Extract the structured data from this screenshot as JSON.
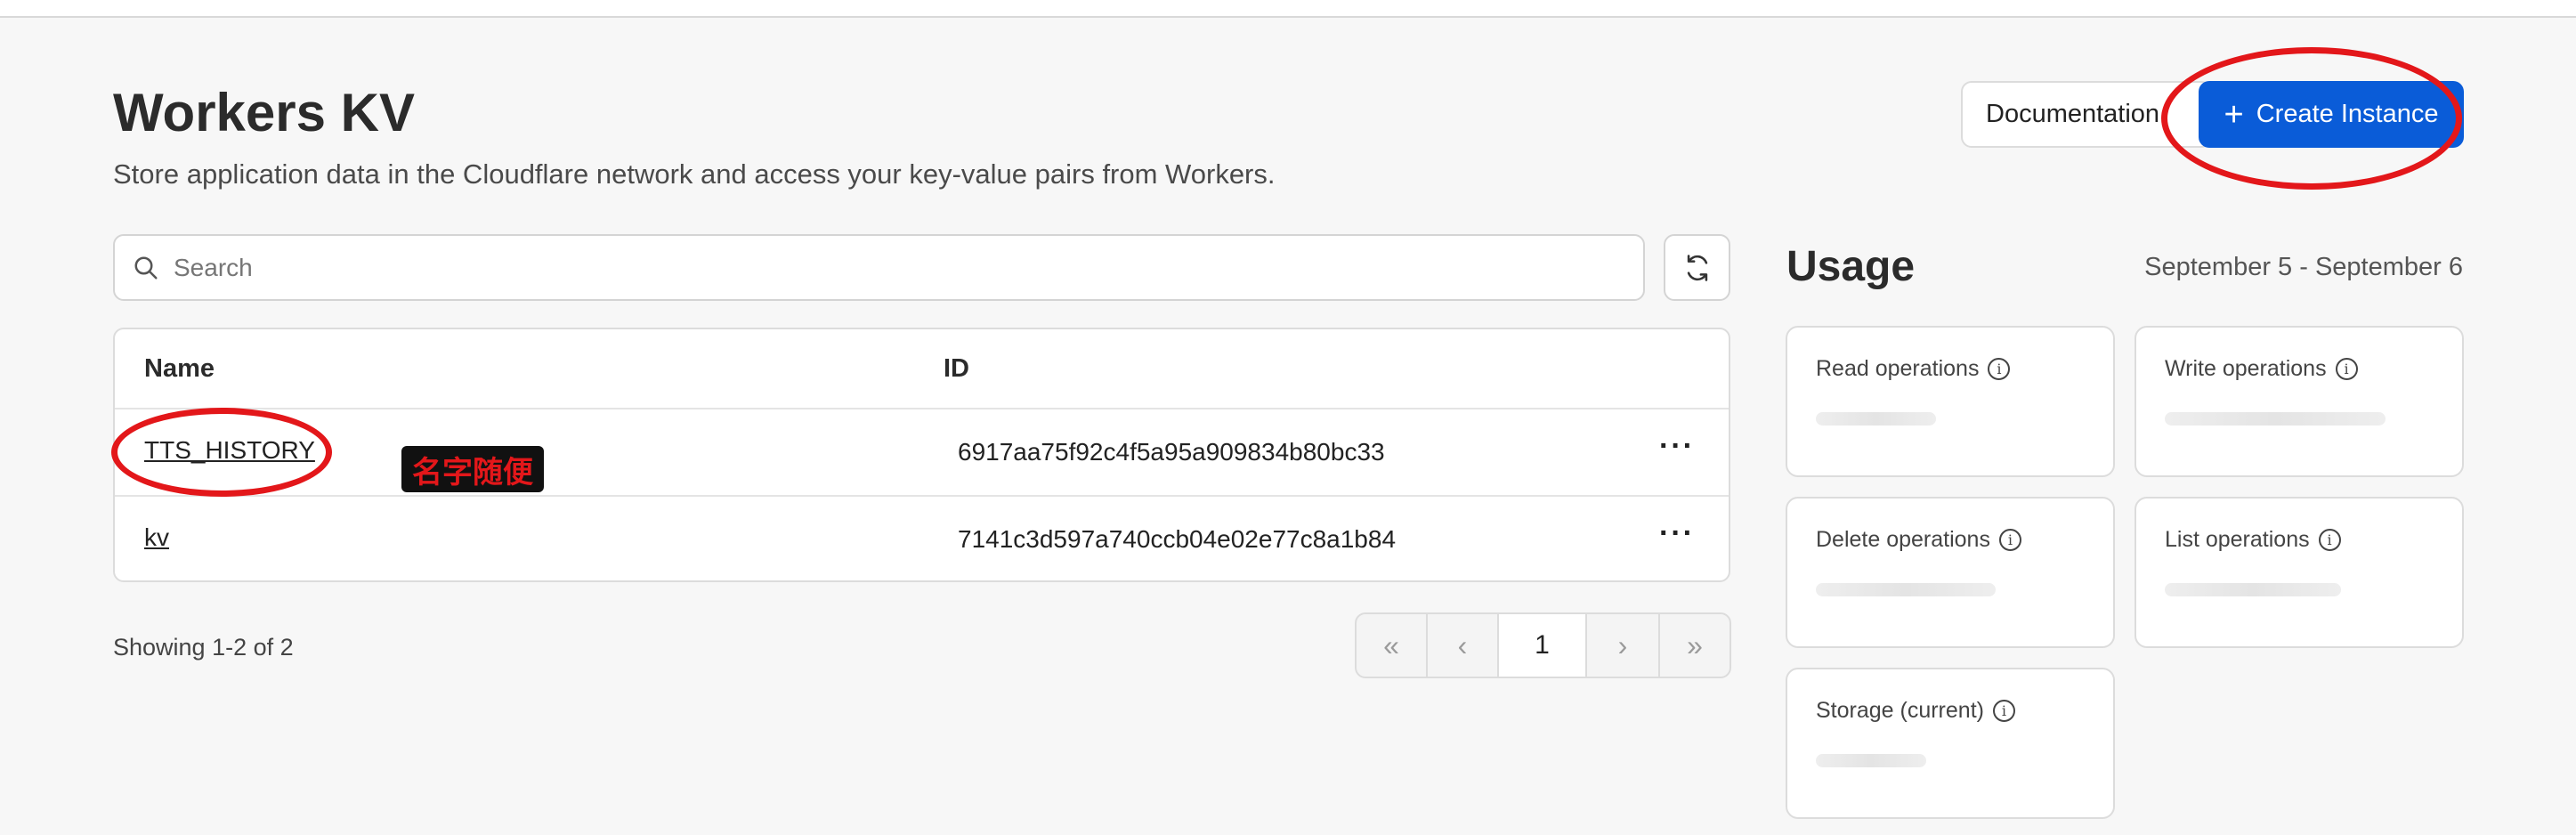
{
  "header": {
    "title": "Workers KV",
    "subtitle": "Store application data in the Cloudflare network and access your key-value pairs from Workers.",
    "documentation_label": "Documentation",
    "create_label": "Create Instance"
  },
  "search": {
    "placeholder": "Search",
    "value": ""
  },
  "table": {
    "columns": [
      "Name",
      "ID"
    ],
    "rows": [
      {
        "name": "TTS_HISTORY",
        "id": "6917aa75f92c4f5a95a909834b80bc33"
      },
      {
        "name": "kv",
        "id": "7141c3d597a740ccb04e02e77c8a1b84"
      }
    ],
    "row_menu": "···"
  },
  "pagination": {
    "showing": "Showing 1-2 of 2",
    "current_page": "1",
    "first": "«",
    "prev": "‹",
    "next": "›",
    "last": "»"
  },
  "usage": {
    "title": "Usage",
    "range": "September 5 - September 6",
    "cards": [
      {
        "label": "Read operations"
      },
      {
        "label": "Write operations"
      },
      {
        "label": "Delete operations"
      },
      {
        "label": "List operations"
      },
      {
        "label": "Storage (current)"
      }
    ]
  },
  "annotation": {
    "label": "名字随便",
    "color": "#e3171a"
  },
  "colors": {
    "primary": "#0a5cd8",
    "annotation": "#e3171a"
  }
}
